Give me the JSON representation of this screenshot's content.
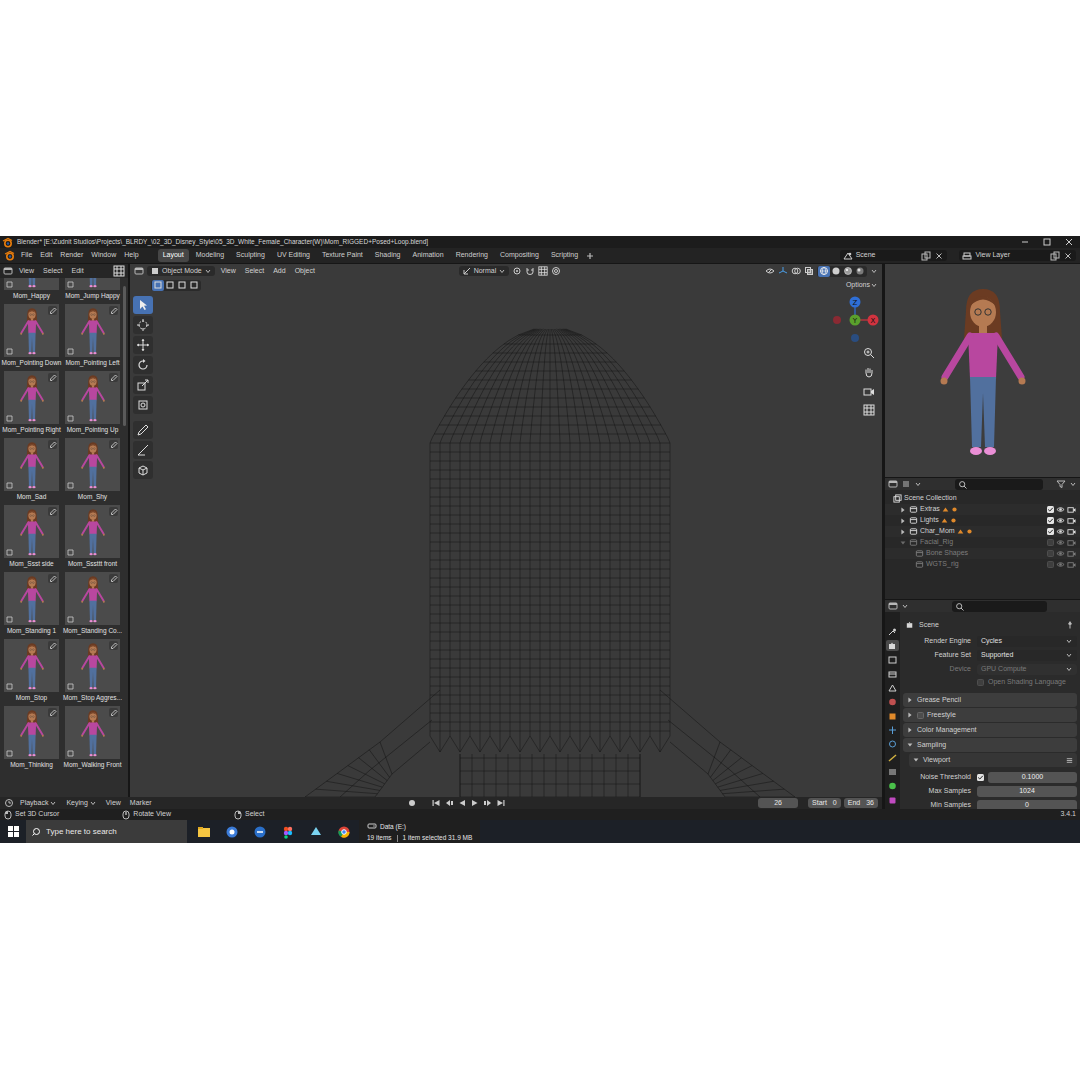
{
  "window": {
    "title": "Blender* [E:\\Zudnit Studios\\Projects\\_BLRDY_\\02_3D_Disney_Style\\05_3D_White_Female_Character(W)\\Mom_RIGGED+Posed+Loop.blend]"
  },
  "menu": [
    "File",
    "Edit",
    "Render",
    "Window",
    "Help"
  ],
  "workspaces": [
    {
      "label": "Layout",
      "selected": true
    },
    {
      "label": "Modeling",
      "selected": false
    },
    {
      "label": "Sculpting",
      "selected": false
    },
    {
      "label": "UV Editing",
      "selected": false
    },
    {
      "label": "Texture Paint",
      "selected": false
    },
    {
      "label": "Shading",
      "selected": false
    },
    {
      "label": "Animation",
      "selected": false
    },
    {
      "label": "Rendering",
      "selected": false
    },
    {
      "label": "Compositing",
      "selected": false
    },
    {
      "label": "Scripting",
      "selected": false
    }
  ],
  "scene_selector": {
    "scene": "Scene",
    "view_layer": "View Layer"
  },
  "asset_browser": {
    "menu": [
      "View",
      "Select",
      "Edit"
    ],
    "assets": [
      "Mom_Happy",
      "Mom_Jump Happy",
      "Mom_Pointing Down",
      "Mom_Pointing Left",
      "Mom_Pointing Right",
      "Mom_Pointing Up",
      "Mom_Sad",
      "Mom_Shy",
      "Mom_Ssst side",
      "Mom_Sssttt front",
      "Mom_Standing 1",
      "Mom_Standing Co...",
      "Mom_Stop",
      "Mom_Stop Aggres...",
      "Mom_Thinking",
      "Mom_Walking Front"
    ]
  },
  "viewport": {
    "mode": "Object Mode",
    "menu": [
      "View",
      "Select",
      "Add",
      "Object"
    ],
    "orientation": "Normal",
    "options": "Options",
    "select_modes": [
      {
        "selected": true
      },
      {
        "selected": false
      },
      {
        "selected": false
      },
      {
        "selected": false
      }
    ],
    "tools": [
      {
        "selected": true
      },
      {
        "selected": false
      },
      {
        "selected": false
      },
      {
        "selected": false
      },
      {
        "selected": false
      },
      {
        "selected": false
      },
      {
        "selected": false
      },
      {
        "selected": false
      },
      {
        "selected": false
      }
    ],
    "shading": [
      {
        "selected": true
      },
      {
        "selected": false
      },
      {
        "selected": false
      },
      {
        "selected": false
      }
    ],
    "gizmo": [
      "X",
      "Y",
      "Z"
    ]
  },
  "outliner": {
    "items": [
      {
        "label": "Scene Collection",
        "kind": "root"
      },
      {
        "label": "Extras",
        "kind": "collection",
        "expanded": false,
        "checked": true
      },
      {
        "label": "Lights",
        "kind": "collection",
        "expanded": false,
        "checked": true
      },
      {
        "label": "Char_Mom",
        "kind": "collection",
        "expanded": false,
        "checked": true
      },
      {
        "label": "Facial_Rig",
        "kind": "collection",
        "expanded": true,
        "checked": false
      },
      {
        "label": "Bone Shapes",
        "kind": "child",
        "checked": false
      },
      {
        "label": "WGTS_rig",
        "kind": "child",
        "checked": false
      }
    ]
  },
  "properties": {
    "tabs": [
      {
        "selected": false
      },
      {
        "selected": true
      },
      {
        "selected": false
      },
      {
        "selected": false
      },
      {
        "selected": false
      },
      {
        "selected": false
      },
      {
        "selected": false
      },
      {
        "selected": false
      },
      {
        "selected": false
      },
      {
        "selected": false
      },
      {
        "selected": false
      },
      {
        "selected": false
      },
      {
        "selected": false
      }
    ],
    "title": "Scene",
    "rows": [
      {
        "kind": "dropdown",
        "label": "Render Engine",
        "value": "Cycles",
        "disabled": false
      },
      {
        "kind": "dropdown",
        "label": "Feature Set",
        "value": "Supported",
        "disabled": false
      },
      {
        "kind": "dropdown",
        "label": "Device",
        "value": "GPU Compute",
        "disabled": true
      },
      {
        "kind": "checkbox",
        "label": "Open Shading Language",
        "checked": false,
        "disabled": true
      },
      {
        "kind": "panel",
        "label": "Grease Pencil",
        "expanded": false
      },
      {
        "kind": "panel",
        "label": "Freestyle",
        "expanded": false,
        "checked": false
      },
      {
        "kind": "panel",
        "label": "Color Management",
        "expanded": false
      },
      {
        "kind": "panel",
        "label": "Sampling",
        "expanded": true
      },
      {
        "kind": "subpanel",
        "label": "Viewport",
        "expanded": true
      },
      {
        "kind": "number",
        "label": "Noise Threshold",
        "value": "0.1000",
        "checked": true
      },
      {
        "kind": "number",
        "label": "Max Samples",
        "value": "1024"
      },
      {
        "kind": "number",
        "label": "Min Samples",
        "value": "0"
      }
    ]
  },
  "timeline": {
    "menu": [
      "Playback",
      "Keying",
      "View",
      "Marker"
    ],
    "frame": "26",
    "start_label": "Start",
    "start": "0",
    "end_label": "End",
    "end": "36"
  },
  "status_bar": {
    "hints": [
      "Set 3D Cursor",
      "Rotate View",
      "Select"
    ],
    "version": "3.4.1"
  },
  "taskbar": {
    "search_placeholder": "Type here to search",
    "explorer": {
      "location": "Data (E:)",
      "count": "19 items",
      "selection": "1 item selected 31.9 MB"
    }
  }
}
